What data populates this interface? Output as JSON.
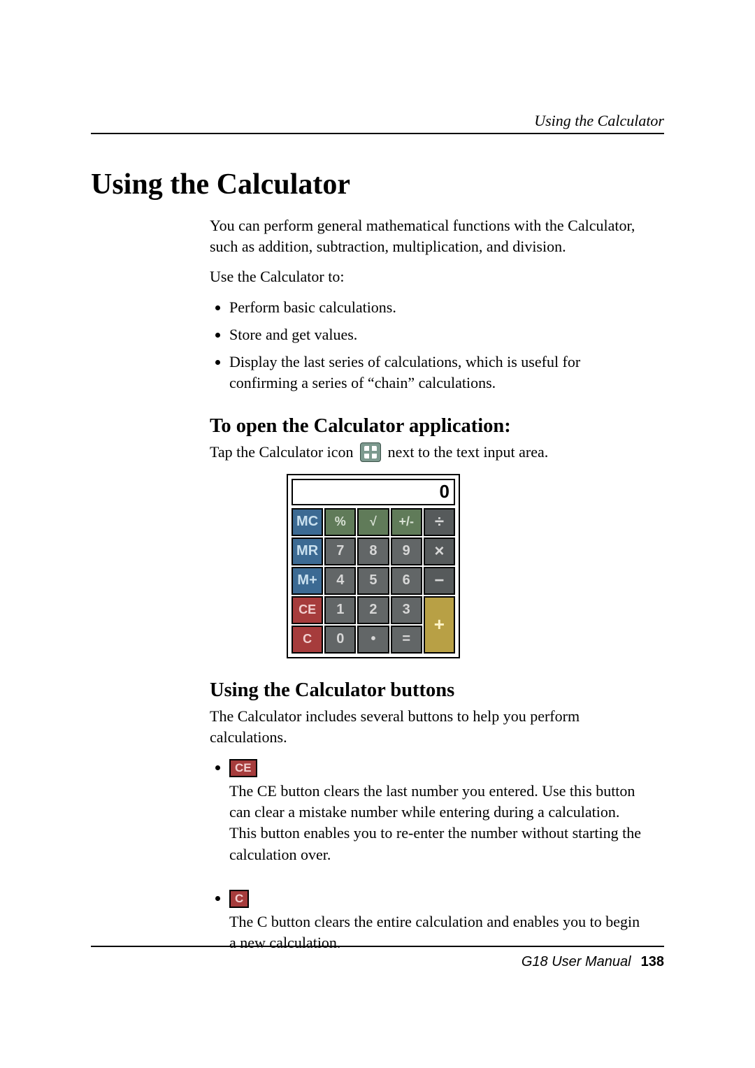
{
  "header": {
    "running": "Using the Calculator"
  },
  "title": "Using the Calculator",
  "intro_paragraph": "You can perform general mathematical functions with the Calculator, such as addition, subtraction, multiplication, and division.",
  "use_lead": "Use the Calculator to:",
  "use_items": [
    "Perform basic calculations.",
    "Store and get values.",
    "Display the last series of calculations, which is useful for confirming a series of “chain” calculations."
  ],
  "open": {
    "heading": "To open the Calculator application:",
    "before_icon": "Tap the Calculator icon",
    "after_icon": " next to the text input area."
  },
  "calculator": {
    "display": "0",
    "keys": {
      "MC": "MC",
      "percent": "%",
      "sqrt": "√",
      "plusminus": "+/-",
      "divide": "÷",
      "MR": "MR",
      "7": "7",
      "8": "8",
      "9": "9",
      "multiply": "×",
      "Mplus": "M+",
      "4": "4",
      "5": "5",
      "6": "6",
      "minus": "−",
      "CE": "CE",
      "1": "1",
      "2": "2",
      "3": "3",
      "plus": "+",
      "C": "C",
      "0": "0",
      "dot": "•",
      "equals": "="
    }
  },
  "buttons_section": {
    "heading": "Using the Calculator buttons",
    "intro": "The Calculator includes several buttons to help you perform calculations.",
    "items": [
      {
        "chip": "CE",
        "text": "The CE button clears the last number you entered. Use this button can clear a mistake number while entering during a calculation. This button enables you to re-enter the number without starting the calculation over."
      },
      {
        "chip": "C",
        "text": "The C button clears the entire calculation and enables you to begin a new calculation."
      }
    ]
  },
  "footer": {
    "manual": "G18 User Manual",
    "page": "138"
  }
}
